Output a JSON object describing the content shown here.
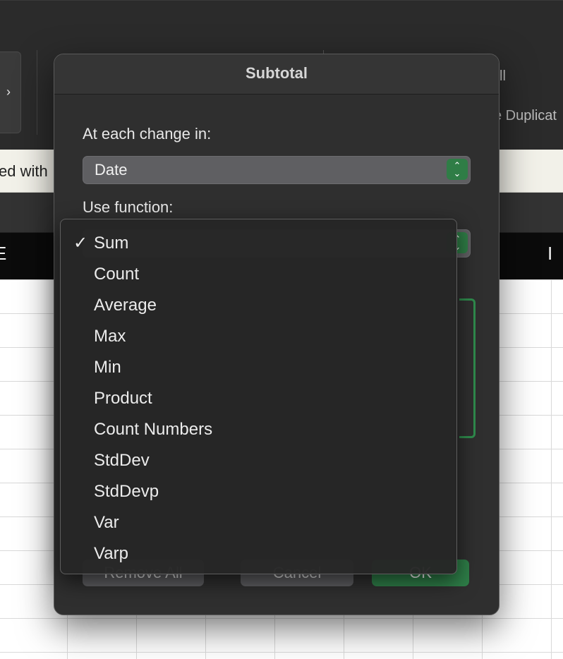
{
  "background": {
    "ribbon_partial_1": "ll",
    "ribbon_partial_2": "e Duplicat",
    "message_partial": "ed with",
    "column_headers": [
      "E",
      "I"
    ],
    "ribbon_scroll_icon": "chevron-right-icon"
  },
  "dialog": {
    "title": "Subtotal",
    "at_each_change_label": "At each change in:",
    "at_each_change_value": "Date",
    "use_function_label": "Use function:",
    "buttons": {
      "remove_all": "Remove All",
      "cancel": "Cancel",
      "ok": "OK"
    }
  },
  "function_menu": {
    "selected": "Sum",
    "items": [
      {
        "label": "Sum",
        "checked": true
      },
      {
        "label": "Count",
        "checked": false
      },
      {
        "label": "Average",
        "checked": false
      },
      {
        "label": "Max",
        "checked": false
      },
      {
        "label": "Min",
        "checked": false
      },
      {
        "label": "Product",
        "checked": false
      },
      {
        "label": "Count Numbers",
        "checked": false
      },
      {
        "label": "StdDev",
        "checked": false
      },
      {
        "label": "StdDevp",
        "checked": false
      },
      {
        "label": "Var",
        "checked": false
      },
      {
        "label": "Varp",
        "checked": false
      }
    ],
    "check_glyph": "✓"
  },
  "colors": {
    "accent_green": "#2f7d46",
    "dialog_bg": "#2f2f2f",
    "menu_bg": "#262626"
  }
}
